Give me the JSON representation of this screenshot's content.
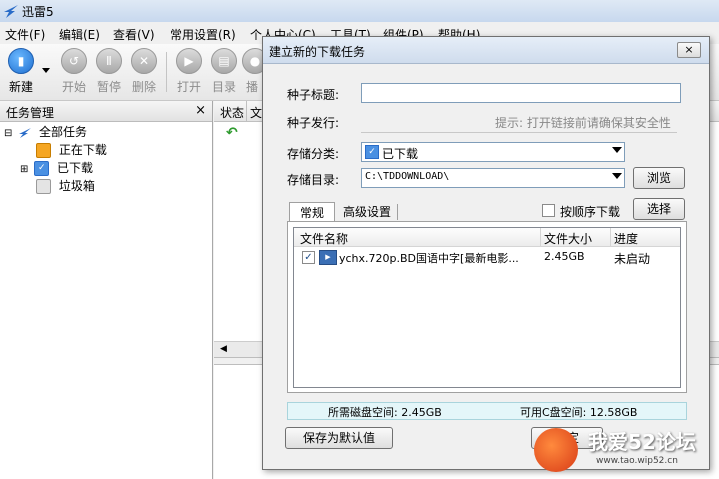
{
  "app": {
    "title": "迅雷5"
  },
  "menu": [
    "文件(F)",
    "编辑(E)",
    "查看(V)",
    "常用设置(R)",
    "个人中心(C)",
    "工具(T)",
    "组件(P)",
    "帮助(H)"
  ],
  "toolbar": {
    "new": "新建",
    "start": "开始",
    "pause": "暂停",
    "delete": "删除",
    "open": "打开",
    "dir": "目录",
    "more": "播"
  },
  "left_panel": {
    "title": "任务管理",
    "close": "×",
    "tree": [
      {
        "label": "全部任务"
      },
      {
        "label": "正在下载"
      },
      {
        "label": "已下载"
      },
      {
        "label": "垃圾箱"
      }
    ]
  },
  "list_header": {
    "status": "状态",
    "col2": "文"
  },
  "dialog": {
    "title": "建立新的下载任务",
    "close": "×",
    "seed_title_label": "种子标题:",
    "seed_publish_label": "种子发行:",
    "hint": "提示: 打开链接前请确保其安全性",
    "category_label": "存储分类:",
    "category_value": "已下载",
    "dir_label": "存储目录:",
    "dir_value": "C:\\TDDOWNLOAD\\",
    "browse": "浏览",
    "tab_normal": "常规",
    "tab_advanced": "高级设置",
    "sequential": "按顺序下载",
    "select": "选择",
    "columns": {
      "name": "文件名称",
      "size": "文件大小",
      "progress": "进度"
    },
    "files": [
      {
        "name": "ychx.720p.BD国语中字[最新电影...",
        "size": "2.45GB",
        "progress": "未启动"
      }
    ],
    "disk_needed": "所需磁盘空间: 2.45GB",
    "disk_available": "可用C盘空间: 12.58GB",
    "save_default": "保存为默认值",
    "ok": "确定"
  },
  "watermark": {
    "text": "我爱52论坛",
    "url": "www.tao.wip52.cn"
  },
  "colors": {
    "accent": "#1f6fd0",
    "hint": "#888888",
    "status_bg": "#e4f6f9"
  }
}
